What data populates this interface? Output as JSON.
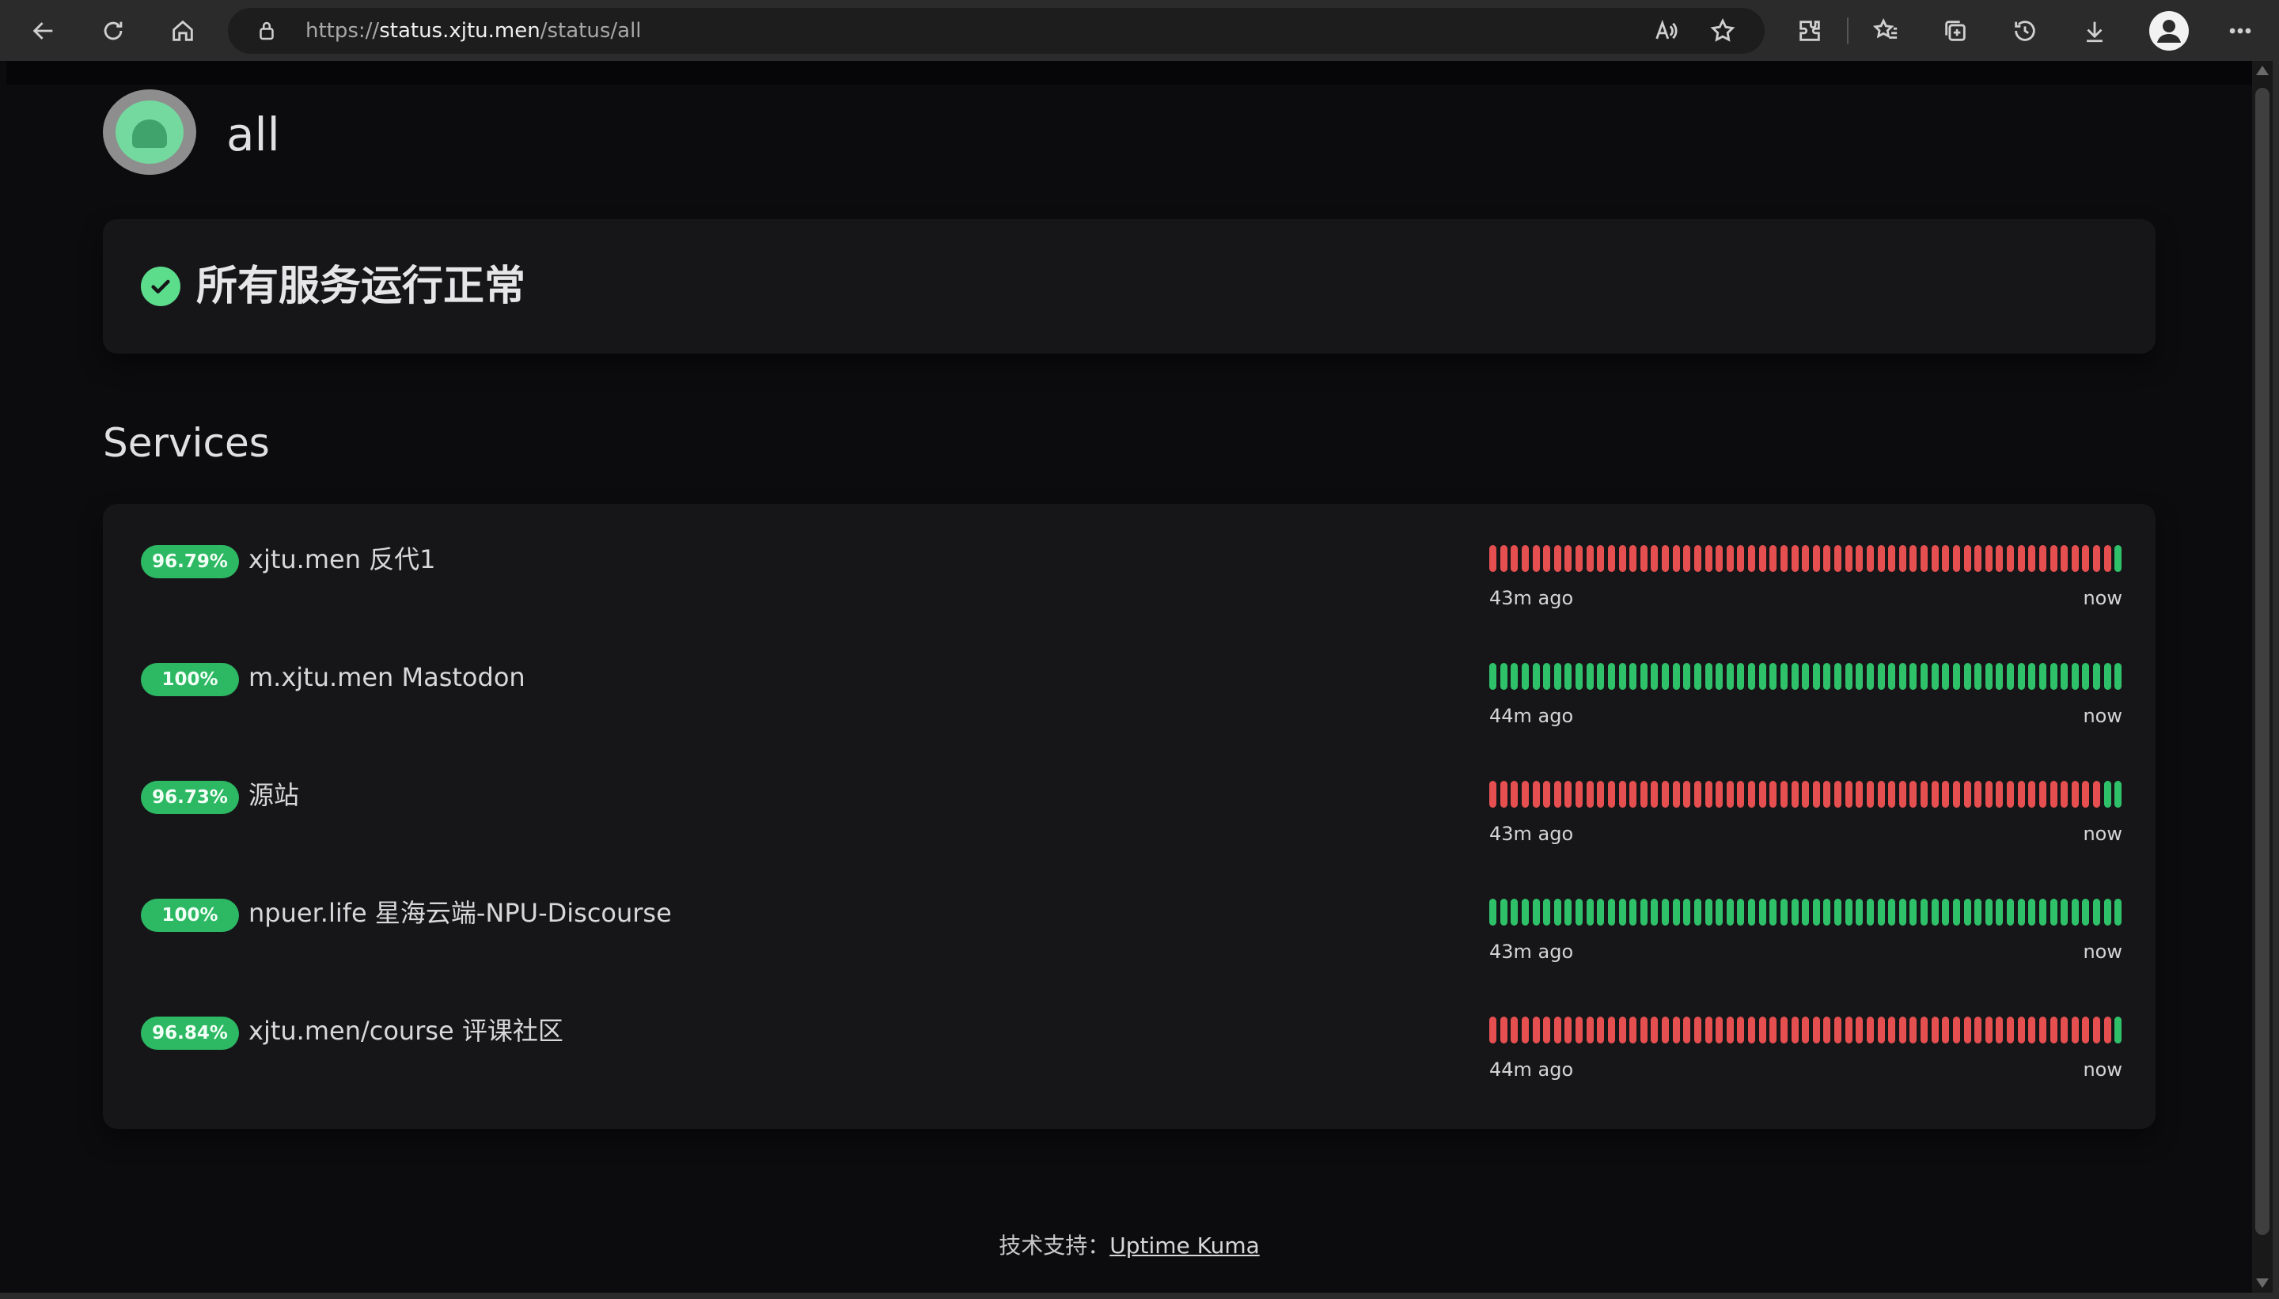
{
  "browser": {
    "url_prefix": "https://",
    "url_host": "status.xjtu.men",
    "url_path": "/status/all"
  },
  "page": {
    "title": "all",
    "overall_status": "所有服务运行正常",
    "section_title": "Services"
  },
  "services": [
    {
      "uptime": "96.79%",
      "name": "xjtu.men 反代1",
      "time_start": "43m ago",
      "time_end": "now",
      "beats": "ddddddddddddddddddddddddddddddddddddddddddddddddddddddddddu"
    },
    {
      "uptime": "100%",
      "name": "m.xjtu.men Mastodon",
      "time_start": "44m ago",
      "time_end": "now",
      "beats": "uuuuuuuuuuuuuuuuuuuuuuuuuuuuuuuuuuuuuuuuuuuuuuuuuuuuuuuuuuu"
    },
    {
      "uptime": "96.73%",
      "name": "源站",
      "time_start": "43m ago",
      "time_end": "now",
      "beats": "ddddddddddddddddddddddddddddddddddddddddddddddddddddddddduu"
    },
    {
      "uptime": "100%",
      "name": "npuer.life 星海云端-NPU-Discourse",
      "time_start": "43m ago",
      "time_end": "now",
      "beats": "uuuuuuuuuuuuuuuuuuuuuuuuuuuuuuuuuuuuuuuuuuuuuuuuuuuuuuuuuuu"
    },
    {
      "uptime": "96.84%",
      "name": "xjtu.men/course 评课社区",
      "time_start": "44m ago",
      "time_end": "now",
      "beats": "ddddddddddddddddddddddddddddddddddddddddddddddddddddddddddu"
    }
  ],
  "footer": {
    "label": "技术支持：",
    "link_text": "Uptime Kuma"
  },
  "colors": {
    "up": "#2fc16a",
    "down": "#e54f4f",
    "badge": "#2db863",
    "background": "#0c0c0e",
    "card": "#161619"
  },
  "icons": [
    "back-icon",
    "refresh-icon",
    "home-icon",
    "lock-icon",
    "read-aloud-icon",
    "favorite-star-icon",
    "extensions-icon",
    "favorites-icon",
    "collections-icon",
    "history-icon",
    "download-icon",
    "profile-icon",
    "more-icon",
    "check-circle-icon",
    "logo-icon"
  ]
}
